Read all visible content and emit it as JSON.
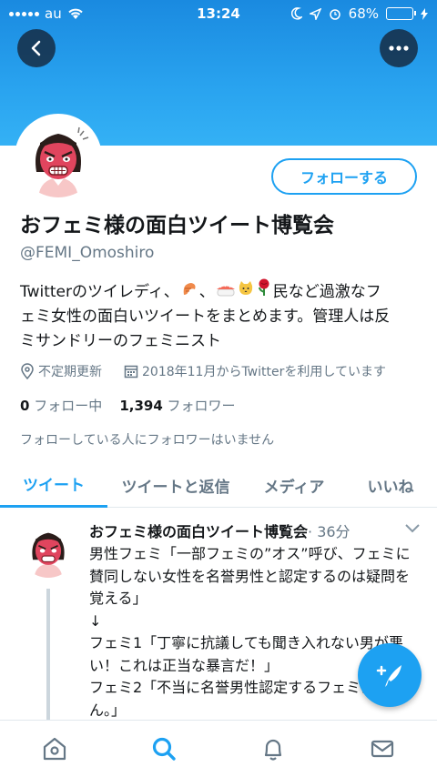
{
  "status_bar": {
    "carrier": "au",
    "time": "13:24",
    "battery": "68%"
  },
  "profile": {
    "name": "おフェミ様の面白ツイート博覧会",
    "handle": "@FEMI_Omoshiro",
    "follow_label": "フォローする",
    "bio_line1_pre": "Twitterのツイレディ、",
    "bio_line1_post": "民など過激なフ",
    "bio_line2": "ェミ女性の面白いツイートをまとめます。管理人は反",
    "bio_line3": "ミサンドリーのフェミニスト",
    "location": "不定期更新",
    "joined": "2018年11月からTwitterを利用しています",
    "following_count": "0",
    "following_label": "フォロー中",
    "followers_count": "1,394",
    "followers_label": "フォロワー",
    "followed_by_note": "フォローしている人にフォロワーはいません"
  },
  "icons": [
    "back-icon",
    "more-icon",
    "location-icon",
    "calendar-icon",
    "chevron-down-icon",
    "compose-icon",
    "home-icon",
    "search-icon",
    "notifications-icon",
    "messages-icon"
  ],
  "tabs": [
    {
      "label": "ツイート"
    },
    {
      "label": "ツイートと返信"
    },
    {
      "label": "メディア"
    },
    {
      "label": "いいね"
    }
  ],
  "tweet": {
    "author": "おフェミ様の面白ツイート博覧会",
    "time": "· 36分",
    "body": "男性フェミ「一部フェミの”オス”呼び、フェミに賛同しない女性を名誉男性と認定するのは疑問を覚える」\n↓\nフェミ1「丁寧に抗議しても聞き入れない男が悪い！これは正当な暴言だ！」\nフェミ2「不当に名誉男性認定するフェミは居ません。」"
  },
  "colors": {
    "accent": "#1da1f2",
    "banner": "#29a3ef",
    "secondary_text": "#657786"
  }
}
